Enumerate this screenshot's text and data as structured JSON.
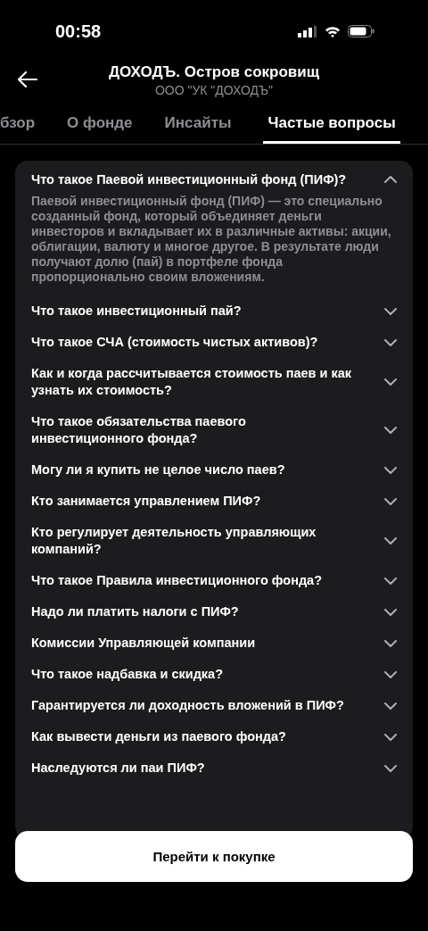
{
  "status_bar": {
    "time": "00:58"
  },
  "header": {
    "title": "ДОХОДЪ. Остров сокровищ",
    "subtitle": "ООО \"УК \"ДОХОДЪ\""
  },
  "tabs": [
    {
      "label": "бзор",
      "selected": false
    },
    {
      "label": "О фонде",
      "selected": false
    },
    {
      "label": "Инсайты",
      "selected": false
    },
    {
      "label": "Частые вопросы",
      "selected": true
    }
  ],
  "faq": [
    {
      "question": "Что такое Паевой инвестиционный фонд (ПИФ)?",
      "expanded": true,
      "answer": "Паевой инвестиционный фонд (ПИФ) — это специально созданный фонд, который объединяет деньги инвесторов и вкладывает их в различные активы: акции, облигации, валюту и многое другое. В результате люди получают долю (пай) в портфеле фонда пропорционально своим вложениям."
    },
    {
      "question": "Что такое инвестиционный пай?",
      "expanded": false
    },
    {
      "question": "Что такое СЧА (стоимость чистых активов)?",
      "expanded": false
    },
    {
      "question": "Как и когда рассчитывается стоимость паев и как узнать их стоимость?",
      "expanded": false
    },
    {
      "question": "Что такое обязательства паевого инвестиционного фонда?",
      "expanded": false
    },
    {
      "question": "Могу ли я купить не целое число паев?",
      "expanded": false
    },
    {
      "question": "Кто занимается управлением ПИФ?",
      "expanded": false
    },
    {
      "question": "Кто регулирует деятельность управляющих компаний?",
      "expanded": false
    },
    {
      "question": "Что такое Правила инвестиционного фонда?",
      "expanded": false
    },
    {
      "question": "Надо ли платить налоги с ПИФ?",
      "expanded": false
    },
    {
      "question": "Комиссии Управляющей компании",
      "expanded": false
    },
    {
      "question": "Что такое надбавка и скидка?",
      "expanded": false
    },
    {
      "question": "Гарантируется ли доходность вложений в ПИФ?",
      "expanded": false
    },
    {
      "question": "Как вывести деньги из паевого фонда?",
      "expanded": false
    },
    {
      "question": "Наследуются ли паи ПИФ?",
      "expanded": false
    }
  ],
  "buy_button": "Перейти к покупке"
}
